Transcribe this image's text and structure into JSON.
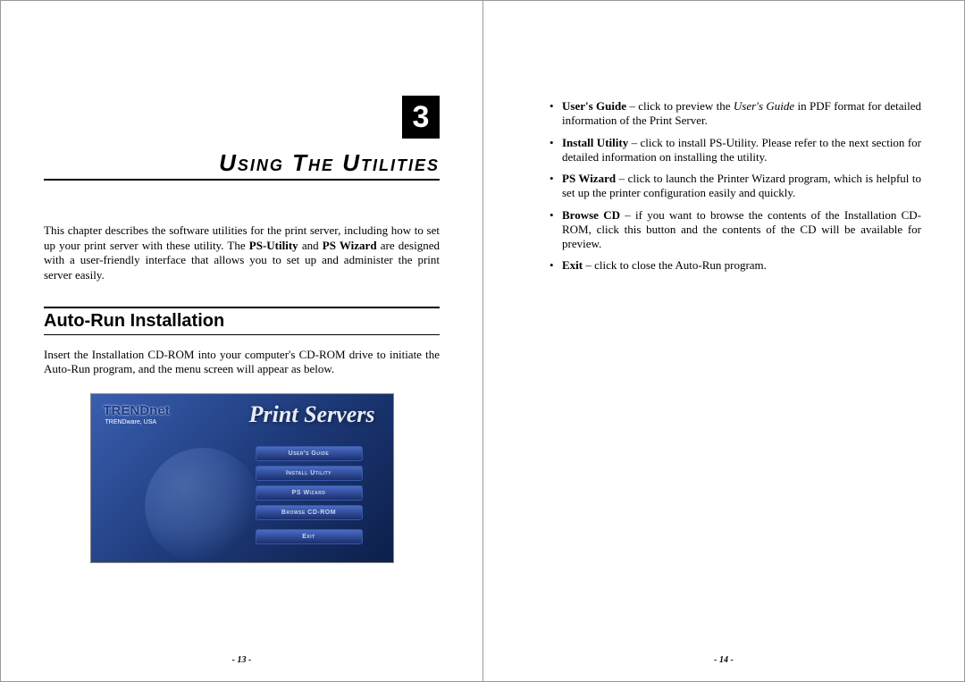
{
  "left": {
    "chapterNum": "3",
    "chapterTitle": "Using The Utilities",
    "intro_part1": "This chapter describes the software utilities for the print server, including how to set up your print server with these utility.   The ",
    "intro_bold1": "PS-Utility",
    "intro_part2": " and ",
    "intro_bold2": "PS Wizard",
    "intro_part3": " are designed with a user-friendly interface that allows you to set up and administer the print server easily.",
    "sectionTitle": "Auto-Run Installation",
    "sectionBody": "Insert the Installation CD-ROM into your computer's CD-ROM drive to initiate the Auto-Run program, and the menu screen will appear as below.",
    "screenshot": {
      "brand": "TRENDnet",
      "brandSub": "TRENDware, USA",
      "productTitle": "Print Servers",
      "menu": [
        "User's Guide",
        "Install Utility",
        "PS Wizard",
        "Browse CD-ROM",
        "Exit"
      ]
    },
    "pageNum": "- 13 -"
  },
  "right": {
    "bullets": [
      {
        "bold": "User's Guide",
        "sep": " – click to preview the ",
        "italic": "User's Guide",
        "rest": " in PDF format for detailed information of the Print Server."
      },
      {
        "bold": "Install Utility",
        "sep": " – click to install PS-Utility.   Please refer to the next section for detailed information on installing the utility.",
        "italic": "",
        "rest": ""
      },
      {
        "bold": "PS Wizard",
        "sep": " – click to launch the Printer Wizard program, which is helpful to set up the printer configuration easily and quickly.",
        "italic": "",
        "rest": ""
      },
      {
        "bold": "Browse CD",
        "sep": " – if you want to browse the contents of the Installation CD-ROM, click this button and the contents of the CD will be available for preview.",
        "italic": "",
        "rest": ""
      },
      {
        "bold": "Exit",
        "sep": " – click to close the Auto-Run program.",
        "italic": "",
        "rest": ""
      }
    ],
    "pageNum": "- 14 -"
  }
}
